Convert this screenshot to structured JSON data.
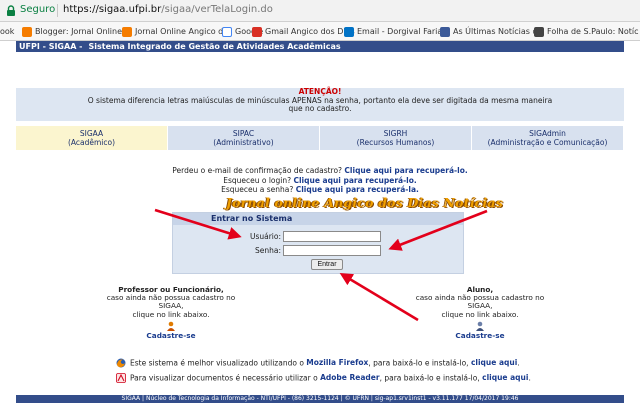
{
  "browser": {
    "secure_label": "Seguro",
    "url_host": "https://sigaa.ufpi.br",
    "url_path": "/sigaa/verTelaLogin.do",
    "bookmarks": [
      {
        "label": "ook",
        "icon": "bookmark-icon",
        "color": "#9e9e9e"
      },
      {
        "label": "Blogger: Jornal Online",
        "icon": "blogger-icon",
        "color": "#f57c00"
      },
      {
        "label": "Jornal Online Angico d",
        "icon": "blogger-icon",
        "color": "#f57c00"
      },
      {
        "label": "Google",
        "icon": "google-icon",
        "color": "#4285f4"
      },
      {
        "label": "Gmail Angico dos Dias",
        "icon": "gmail-icon",
        "color": "#d93025"
      },
      {
        "label": "Email - Dorgival Farias",
        "icon": "outlook-icon",
        "color": "#0072c6"
      },
      {
        "label": "As Últimas Notícias do",
        "icon": "news-icon",
        "color": "#3b5998"
      },
      {
        "label": "Folha de S.Paulo: Notíc",
        "icon": "folha-icon",
        "color": "#444444"
      }
    ]
  },
  "header": {
    "brand": "UFPI - SIGAA -",
    "subtitle": "Sistema Integrado de Gestão de Atividades Acadêmicas"
  },
  "warning": {
    "title": "ATENÇÃO!",
    "line1": "O sistema diferencia letras maiúsculas de minúsculas APENAS na senha, portanto ela deve ser digitada da mesma maneira",
    "line2": "que no cadastro."
  },
  "systems": [
    {
      "name": "SIGAA",
      "desc": "(Acadêmico)"
    },
    {
      "name": "SIPAC",
      "desc": "(Administrativo)"
    },
    {
      "name": "SIGRH",
      "desc": "(Recursos Humanos)"
    },
    {
      "name": "SIGAdmin",
      "desc": "(Administração e Comunicação)"
    }
  ],
  "recovery": {
    "line1_text": "Perdeu o e-mail de confirmação de cadastro?",
    "line1_link": "Clique aqui para recuperá-lo.",
    "line2_text": "Esqueceu o login?",
    "line2_link": "Clique aqui para recuperá-lo.",
    "line3_text": "Esqueceu a senha?",
    "line3_link": "Clique aqui para recuperá-la."
  },
  "watermark": "Jornal online Angico dos Dias Notícias",
  "login": {
    "title": "Entrar no Sistema",
    "user_label": "Usuário:",
    "password_label": "Senha:",
    "submit_label": "Entrar"
  },
  "professor": {
    "head": "Professor ou Funcionário,",
    "line1": "caso ainda não possua cadastro no SIGAA,",
    "line2": "clique no link abaixo.",
    "link": "Cadastre-se"
  },
  "student": {
    "head": "Aluno,",
    "line1": "caso ainda não possua cadastro no SIGAA,",
    "line2": "clique no link abaixo.",
    "link": "Cadastre-se"
  },
  "info": {
    "firefox_text": "Este sistema é melhor visualizado utilizando o",
    "firefox_link": "Mozilla Firefox",
    "firefox_mid": ", para baixá-lo e instalá-lo,",
    "firefox_click": "clique aqui",
    "reader_text": "Para visualizar documentos é necessário utilizar o",
    "reader_link": "Adobe Reader",
    "reader_mid": ", para baixá-lo e instalá-lo,",
    "reader_click": "clique aqui"
  },
  "footer": "SIGAA | Núcleo de Tecnologia da Informação - NTI/UFPI - (86) 3215-1124 | © UFRN | sig-ap1.srv1inst1 - v3.11.177 17/04/2017 19:46",
  "colors": {
    "header_bg": "#334d8a",
    "panel_bg": "#dde6f2",
    "active_tab": "#fbf5cf",
    "arrow": "#e3001b",
    "link": "#1a3c8e"
  }
}
